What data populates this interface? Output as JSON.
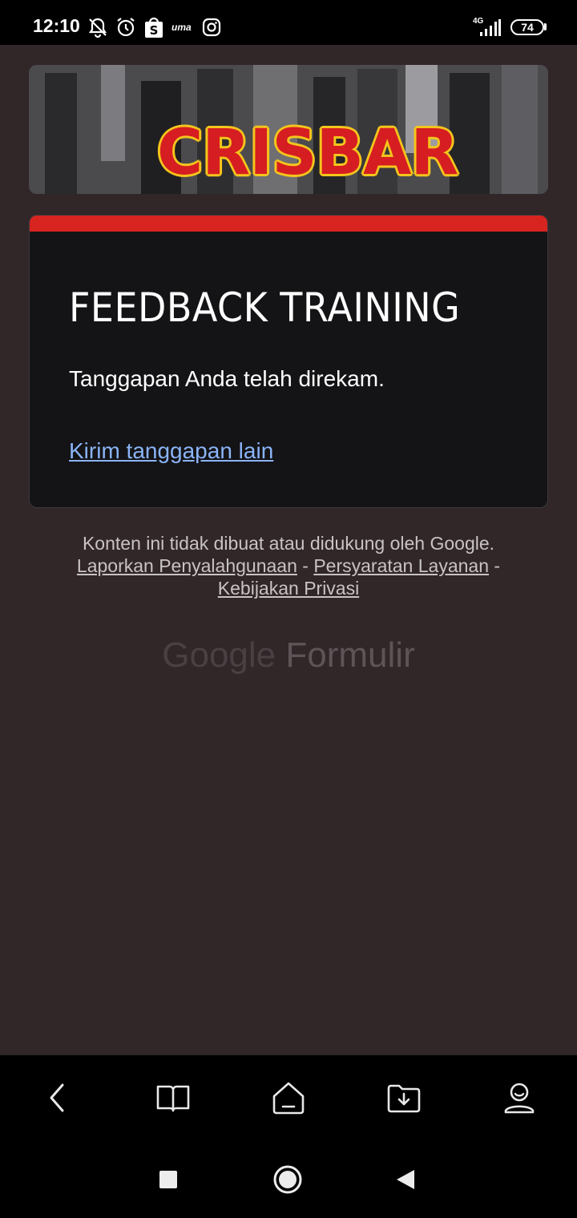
{
  "status_bar": {
    "time": "12:10",
    "network": "4G",
    "battery": "74",
    "icons": [
      "bell-off-icon",
      "alarm-icon",
      "shopee-icon",
      "ummma-icon",
      "instagram-icon",
      "signal-icon",
      "battery-icon"
    ],
    "ummma_label": "uma"
  },
  "banner": {
    "logo_text": "CRISBAR"
  },
  "card": {
    "title": "FEEDBACK TRAINING",
    "message": "Tanggapan Anda telah direkam.",
    "link": "Kirim tanggapan lain",
    "accent_color": "#d7241f"
  },
  "footer": {
    "disclaimer": "Konten ini tidak dibuat atau didukung oleh Google.",
    "link_abuse": "Laporkan Penyalahgunaan",
    "separator": "-",
    "link_terms": "Persyaratan Layanan",
    "link_privacy": "Kebijakan Privasi",
    "brand_google": "Google",
    "brand_forms": "Formulir"
  },
  "toolbar": {
    "icons": [
      "back-icon",
      "book-icon",
      "home-icon",
      "download-icon",
      "profile-icon"
    ]
  },
  "nav": {
    "icons": [
      "recents-icon",
      "home-circle-icon",
      "back-triangle-icon"
    ]
  }
}
